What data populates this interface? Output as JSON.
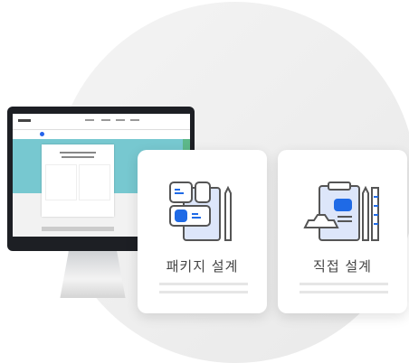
{
  "cards": [
    {
      "label": "패키지 설계",
      "icon": "package-design-icon"
    },
    {
      "label": "직접 설계",
      "icon": "clipboard-design-icon"
    }
  ],
  "colors": {
    "accent": "#1f6ae6",
    "hero": "#77c8d0"
  }
}
